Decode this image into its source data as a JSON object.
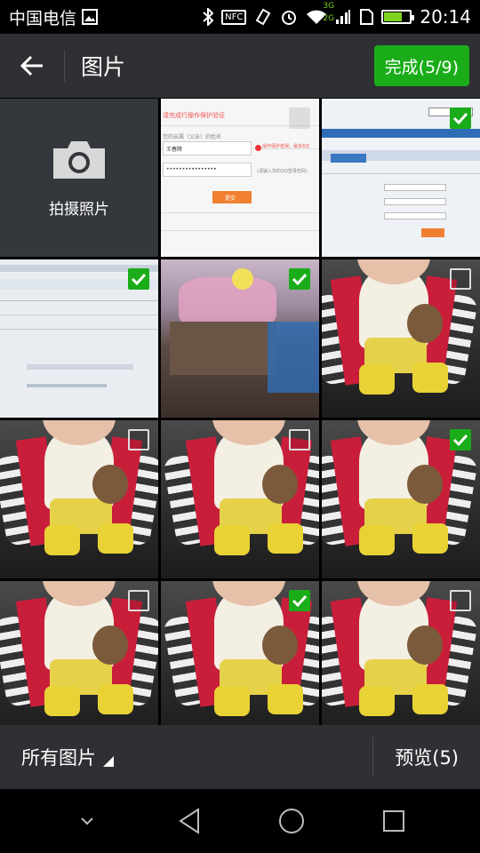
{
  "status_bar": {
    "carrier": "中国电信",
    "network_3g_top": "3G",
    "network_3g_bottom": "2G",
    "nfc": "NFC",
    "time": "20:14",
    "battery_level": 0.7,
    "battery_color": "#7fd320"
  },
  "title_bar": {
    "title": "图片",
    "done_label": "完成(5/9)",
    "accent": "#1aad19"
  },
  "grid": {
    "camera_label": "拍摄照片",
    "form_thumb": {
      "warning": "请完成行操作保护验证",
      "relation_label": "您的亲属（父亲）的姓名",
      "name_value": "王春降",
      "warning_right": "操作保护错误，最多8次",
      "masked": "••••••••••••••••",
      "hint": "(请输入您的QQ登录密码)",
      "button": "提交"
    },
    "items": [
      {
        "type": "camera"
      },
      {
        "type": "form",
        "checked": false
      },
      {
        "type": "web",
        "checked": true
      },
      {
        "type": "web2",
        "checked": true
      },
      {
        "type": "room",
        "checked": true
      },
      {
        "type": "baby",
        "checked": false
      },
      {
        "type": "baby",
        "checked": false
      },
      {
        "type": "baby",
        "checked": false
      },
      {
        "type": "baby",
        "checked": true
      },
      {
        "type": "baby",
        "checked": false
      },
      {
        "type": "baby",
        "checked": true
      },
      {
        "type": "baby",
        "checked": false
      }
    ]
  },
  "bottom_bar": {
    "album_label": "所有图片",
    "preview_label": "预览(5)"
  },
  "icons": {
    "back": "arrow-left-icon",
    "camera": "camera-icon",
    "check": "check-icon",
    "nav_down": "chevron-down-icon",
    "nav_back": "triangle-back-icon",
    "nav_home": "circle-home-icon",
    "nav_recent": "square-recent-icon"
  }
}
